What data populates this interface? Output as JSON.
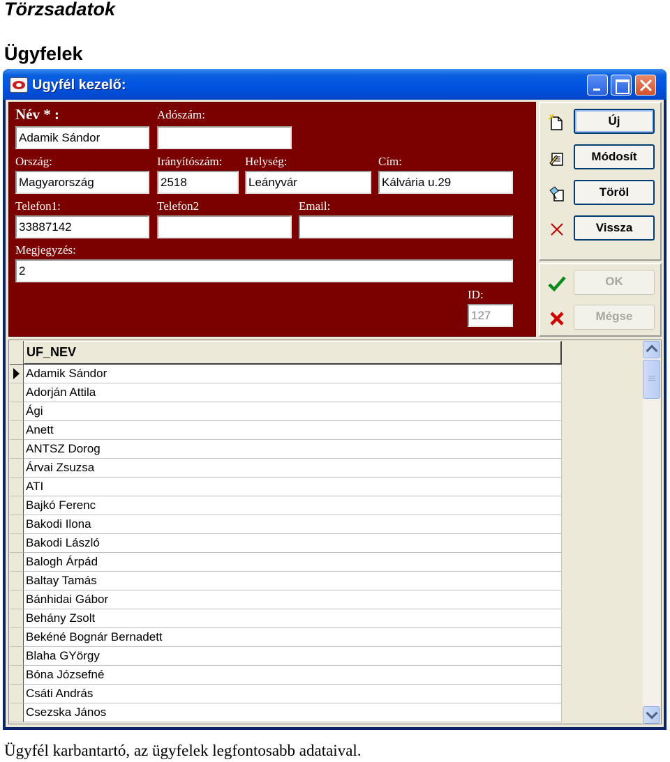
{
  "document": {
    "heading1": "Törzsadatok",
    "heading2": "Ügyfelek",
    "caption": "Ügyfél karbantartó, az ügyfelek legfontosabb adataival."
  },
  "window": {
    "title": "Ugyfél kezelő:",
    "controls": [
      "minimize-icon",
      "maximize-icon",
      "close-icon"
    ]
  },
  "form": {
    "labels": {
      "nev": "Név * :",
      "adoszam": "Adószám:",
      "orszag": "Ország:",
      "iranyitoszam": "Irányítószám:",
      "helyseg": "Helység:",
      "cim": "Cím:",
      "telefon1": "Telefon1:",
      "telefon2": "Telefon2",
      "email": "Email:",
      "megjegyzes": "Megjegyzés:",
      "id": "ID:"
    },
    "values": {
      "nev": "Adamik Sándor",
      "adoszam": "",
      "orszag": "Magyarország",
      "iranyitoszam": "2518",
      "helyseg": "Leányvár",
      "cim": "Kálvária u.29",
      "telefon1": "33887142",
      "telefon2": "",
      "email": "",
      "megjegyzes": "2",
      "id": "127"
    }
  },
  "buttons": {
    "uj": "Új",
    "modosit": "Módosít",
    "torol": "Töröl",
    "vissza": "Vissza",
    "ok": "OK",
    "megse": "Mégse"
  },
  "icons": {
    "uj": "new-document-icon",
    "modosit": "edit-document-icon",
    "torol": "delete-eraser-icon",
    "vissza": "back-cross-icon",
    "ok": "checkmark-icon",
    "megse": "cancel-cross-icon"
  },
  "colors": {
    "form_background": "#7B0000",
    "titlebar": "#0054E3",
    "window_face": "#ECE9D8"
  },
  "grid": {
    "column_header": "UF_NEV",
    "current_row": 0,
    "rows": [
      "Adamik Sándor",
      "Adorján Attila",
      "Ági",
      "Anett",
      "ANTSZ Dorog",
      "Árvai Zsuzsa",
      "ATI",
      "Bajkó Ferenc",
      "Bakodi Ilona",
      "Bakodi László",
      "Balogh Árpád",
      "Baltay Tamás",
      "Bánhidai Gábor",
      "Behány Zsolt",
      "Bekéné Bognár Bernadett",
      "Blaha  GYörgy",
      "Bóna Józsefné",
      "Csáti András",
      "Csezska János"
    ]
  }
}
